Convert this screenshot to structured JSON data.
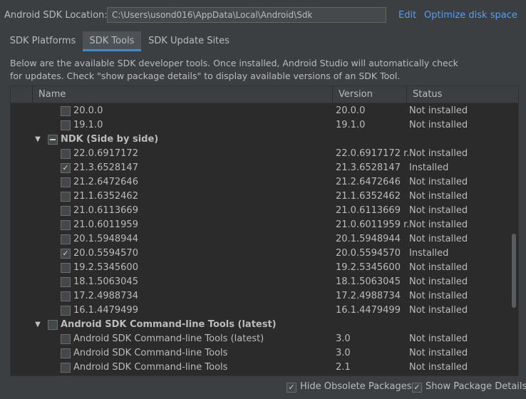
{
  "location": {
    "label": "Android SDK Location:",
    "path": "C:\\Users\\usond016\\AppData\\Local\\Android\\Sdk",
    "edit_link": "Edit",
    "optimize_link": "Optimize disk space"
  },
  "tabs": [
    {
      "label": "SDK Platforms",
      "active": false
    },
    {
      "label": "SDK Tools",
      "active": true
    },
    {
      "label": "SDK Update Sites",
      "active": false
    }
  ],
  "description": {
    "line1": "Below are the available SDK developer tools. Once installed, Android Studio will automatically check",
    "line2": "for updates. Check \"show package details\" to display available versions of an SDK Tool."
  },
  "table": {
    "columns": {
      "name": "Name",
      "version": "Version",
      "status": "Status"
    },
    "rows": [
      {
        "kind": "item",
        "name": "20.0.0",
        "version": "20.0.0",
        "status": "Not installed",
        "checked": false
      },
      {
        "kind": "item",
        "name": "19.1.0",
        "version": "19.1.0",
        "status": "Not installed",
        "checked": false
      },
      {
        "kind": "group",
        "name": "NDK (Side by side)",
        "expanded": true,
        "checkbox": "partial"
      },
      {
        "kind": "item",
        "name": "22.0.6917172",
        "version": "22.0.6917172 r...",
        "status": "Not installed",
        "checked": false
      },
      {
        "kind": "item",
        "name": "21.3.6528147",
        "version": "21.3.6528147",
        "status": "Installed",
        "checked": true
      },
      {
        "kind": "item",
        "name": "21.2.6472646",
        "version": "21.2.6472646",
        "status": "Not installed",
        "checked": false
      },
      {
        "kind": "item",
        "name": "21.1.6352462",
        "version": "21.1.6352462",
        "status": "Not installed",
        "checked": false
      },
      {
        "kind": "item",
        "name": "21.0.6113669",
        "version": "21.0.6113669",
        "status": "Not installed",
        "checked": false
      },
      {
        "kind": "item",
        "name": "21.0.6011959",
        "version": "21.0.6011959 r...",
        "status": "Not installed",
        "checked": false
      },
      {
        "kind": "item",
        "name": "20.1.5948944",
        "version": "20.1.5948944",
        "status": "Not installed",
        "checked": false
      },
      {
        "kind": "item",
        "name": "20.0.5594570",
        "version": "20.0.5594570",
        "status": "Installed",
        "checked": true
      },
      {
        "kind": "item",
        "name": "19.2.5345600",
        "version": "19.2.5345600",
        "status": "Not installed",
        "checked": false
      },
      {
        "kind": "item",
        "name": "18.1.5063045",
        "version": "18.1.5063045",
        "status": "Not installed",
        "checked": false
      },
      {
        "kind": "item",
        "name": "17.2.4988734",
        "version": "17.2.4988734",
        "status": "Not installed",
        "checked": false
      },
      {
        "kind": "item",
        "name": "16.1.4479499",
        "version": "16.1.4479499",
        "status": "Not installed",
        "checked": false
      },
      {
        "kind": "group",
        "name": "Android SDK Command-line Tools (latest)",
        "expanded": true,
        "checkbox": "unchecked"
      },
      {
        "kind": "item",
        "name": "Android SDK Command-line Tools (latest)",
        "version": "3.0",
        "status": "Not installed",
        "checked": false
      },
      {
        "kind": "item",
        "name": "Android SDK Command-line Tools",
        "version": "3.0",
        "status": "Not installed",
        "checked": false
      },
      {
        "kind": "item",
        "name": "Android SDK Command-line Tools",
        "version": "2.1",
        "status": "Not installed",
        "checked": false
      }
    ]
  },
  "footer": {
    "hide_obsolete": {
      "label": "Hide Obsolete Packages",
      "checked": true
    },
    "show_details": {
      "label": "Show Package Details",
      "checked": true
    }
  },
  "icons": {
    "expanded_arrow": "triangle-down-icon",
    "checkmark": "checkmark-icon"
  }
}
